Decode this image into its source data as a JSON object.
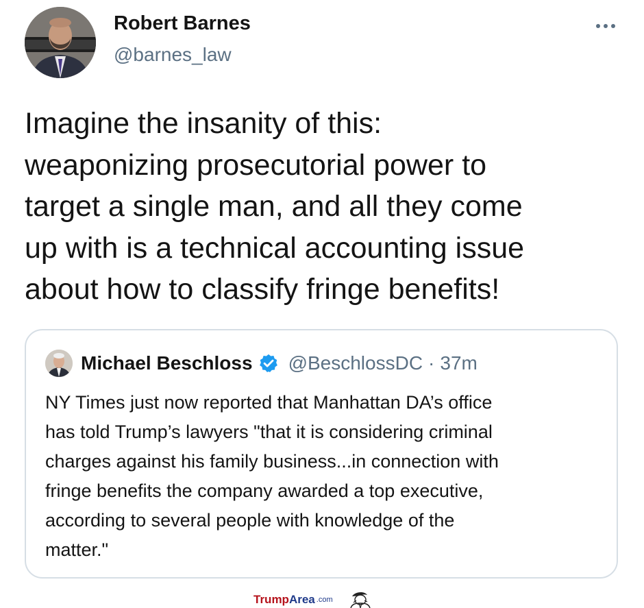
{
  "tweet": {
    "author": {
      "name": "Robert Barnes",
      "handle": "@barnes_law",
      "avatar_icon": "person-avatar-icon"
    },
    "more_icon": "more-horizontal-icon",
    "text_lines": [
      "Imagine the insanity of this:",
      "weaponizing prosecutorial power to",
      "target a single man, and all they come",
      "up with is a technical accounting issue",
      "about how to classify fringe benefits!"
    ]
  },
  "quoted_tweet": {
    "author": {
      "name": "Michael Beschloss",
      "verified": true,
      "handle": "@BeschlossDC",
      "separator": "·",
      "time": "37m",
      "avatar_icon": "person-avatar-icon"
    },
    "text_lines": [
      "NY Times just now reported that Manhattan DA’s office",
      "has told Trump’s lawyers \"that it is considering criminal",
      "charges against his family business...in connection with",
      "fringe benefits the company awarded a top executive,",
      "according to several people with knowledge of the",
      "matter.\""
    ]
  },
  "watermark": {
    "part_red": "Trump",
    "part_blue": "Area",
    "suffix": ".com"
  },
  "colors": {
    "text": "#141414",
    "secondary_text": "#5b7083",
    "verified_blue": "#1d9bf0",
    "card_border": "#d6dee5",
    "watermark_red": "#b5121b",
    "watermark_blue": "#1f3a8a"
  }
}
